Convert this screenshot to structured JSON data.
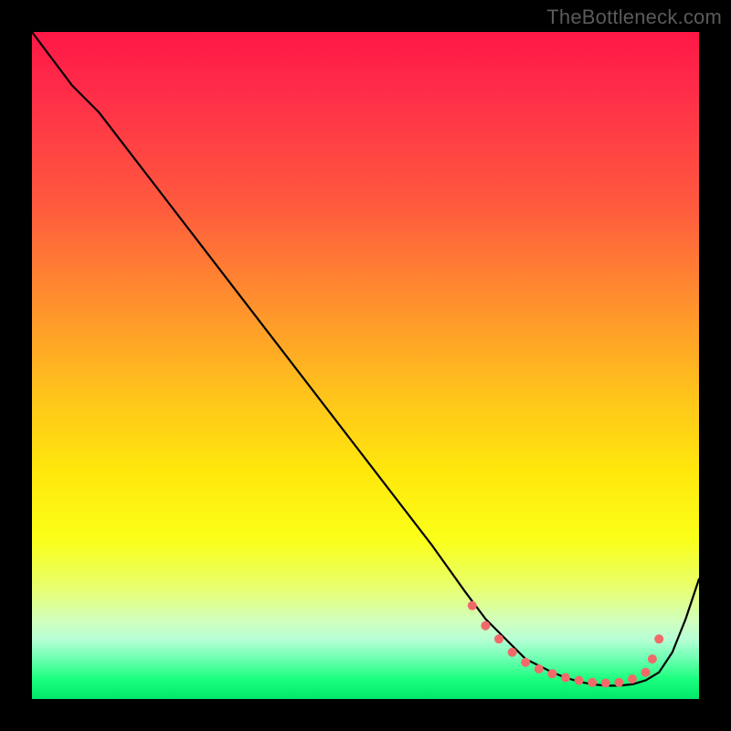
{
  "source_label": "TheBottleneck.com",
  "colors": {
    "curve": "#000000",
    "marker": "#f06a6a",
    "background_frame": "#000000"
  },
  "chart_data": {
    "type": "line",
    "title": "",
    "xlabel": "",
    "ylabel": "",
    "xlim": [
      0,
      100
    ],
    "ylim": [
      0,
      100
    ],
    "series": [
      {
        "name": "curve",
        "x": [
          0,
          6,
          10,
          20,
          30,
          40,
          50,
          60,
          65,
          68,
          70,
          72,
          74,
          76,
          78,
          80,
          82,
          84,
          86,
          88,
          90,
          92,
          94,
          96,
          98,
          100
        ],
        "y": [
          100,
          92,
          88,
          75,
          62,
          49,
          36,
          23,
          16,
          12,
          10,
          8,
          6,
          5,
          4,
          3.2,
          2.6,
          2.2,
          2,
          2,
          2.2,
          2.8,
          4,
          7,
          12,
          18
        ]
      }
    ],
    "markers": {
      "name": "highlight-points",
      "color": "#f06a6a",
      "radius_px": 5,
      "points": [
        {
          "x": 66,
          "y": 14
        },
        {
          "x": 68,
          "y": 11
        },
        {
          "x": 70,
          "y": 9
        },
        {
          "x": 72,
          "y": 7
        },
        {
          "x": 74,
          "y": 5.5
        },
        {
          "x": 76,
          "y": 4.5
        },
        {
          "x": 78,
          "y": 3.8
        },
        {
          "x": 80,
          "y": 3.2
        },
        {
          "x": 82,
          "y": 2.8
        },
        {
          "x": 84,
          "y": 2.5
        },
        {
          "x": 86,
          "y": 2.4
        },
        {
          "x": 88,
          "y": 2.5
        },
        {
          "x": 90,
          "y": 3
        },
        {
          "x": 92,
          "y": 4
        },
        {
          "x": 93,
          "y": 6
        },
        {
          "x": 94,
          "y": 9
        }
      ]
    },
    "background_gradient": {
      "direction": "top-to-bottom",
      "stops": [
        {
          "pos": 0.0,
          "color": "#ff1846"
        },
        {
          "pos": 0.4,
          "color": "#ff8e2e"
        },
        {
          "pos": 0.66,
          "color": "#ffe80c"
        },
        {
          "pos": 0.88,
          "color": "#d3ffb9"
        },
        {
          "pos": 1.0,
          "color": "#00e86a"
        }
      ]
    }
  }
}
